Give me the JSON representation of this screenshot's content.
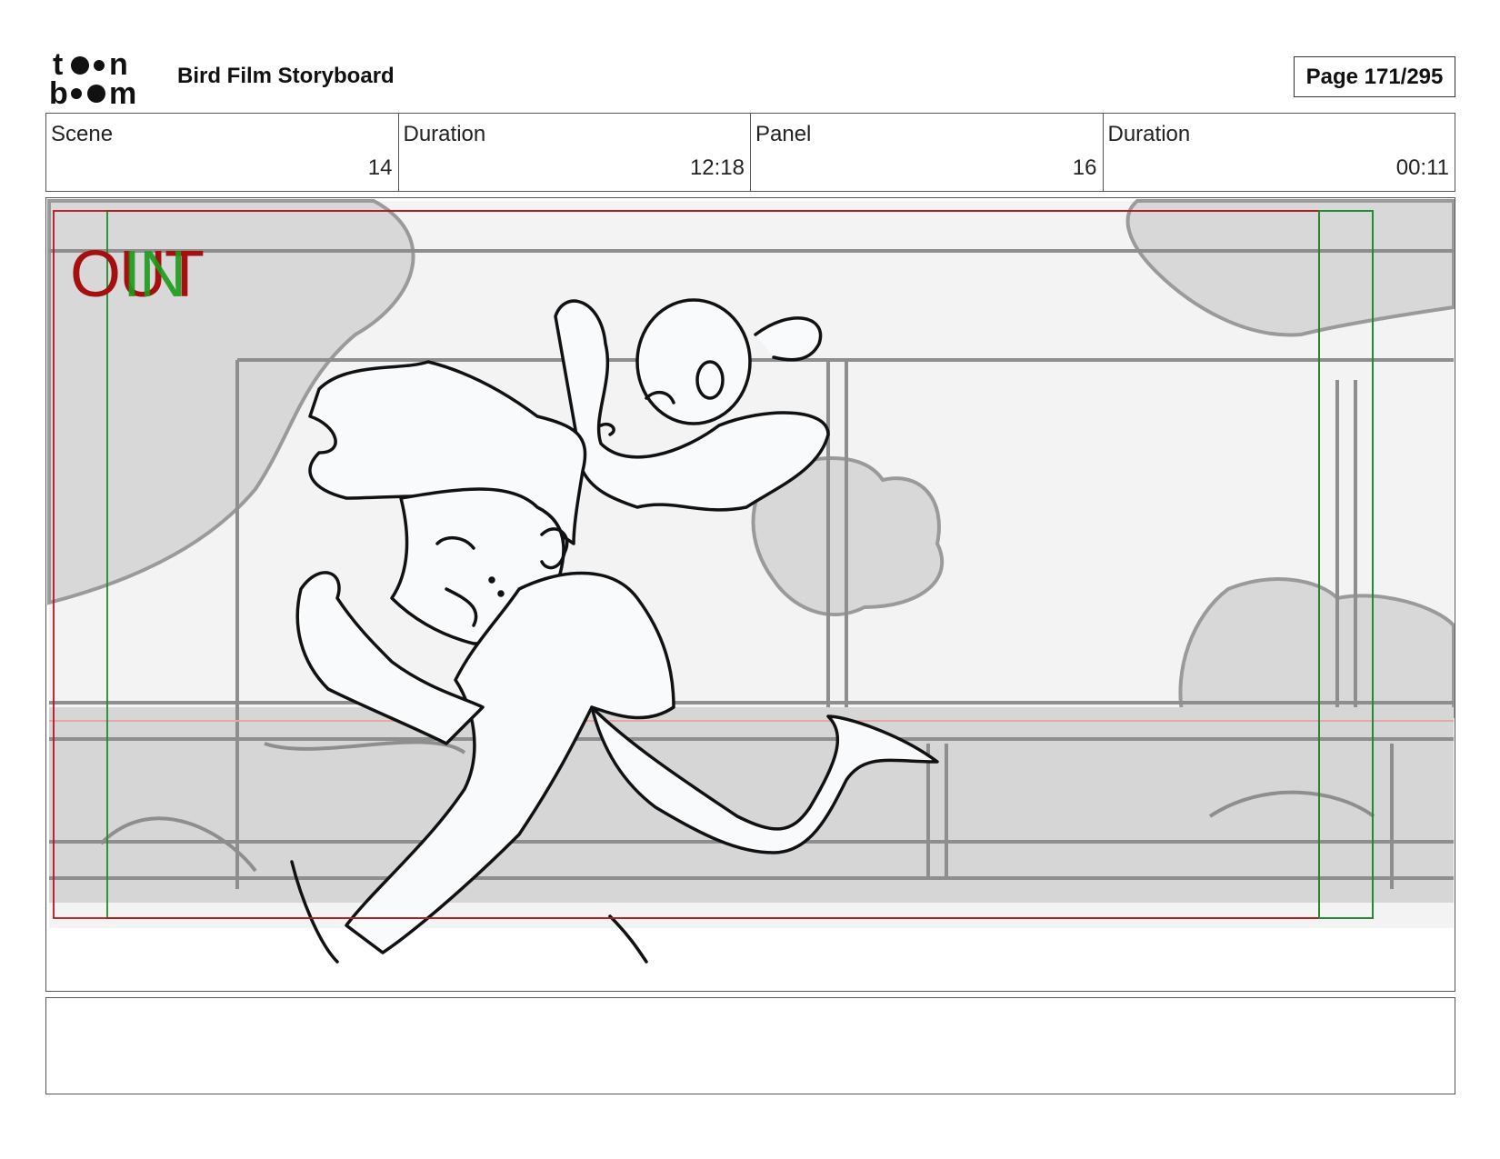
{
  "header": {
    "logo_text": "toon boom",
    "title": "Bird Film Storyboard",
    "page": "Page 171/295"
  },
  "info": [
    {
      "label": "Scene",
      "value": "14"
    },
    {
      "label": "Duration",
      "value": "12:18"
    },
    {
      "label": "Panel",
      "value": "16"
    },
    {
      "label": "Duration",
      "value": "00:11"
    }
  ],
  "panel": {
    "out_label": "OUT",
    "in_label": "IN",
    "colors": {
      "out_frame": "#b3161b",
      "in_frame": "#1f8a2e",
      "background_gray": "#d9d9d9",
      "sketch_line": "#111111"
    }
  },
  "notes": {
    "text": ""
  }
}
